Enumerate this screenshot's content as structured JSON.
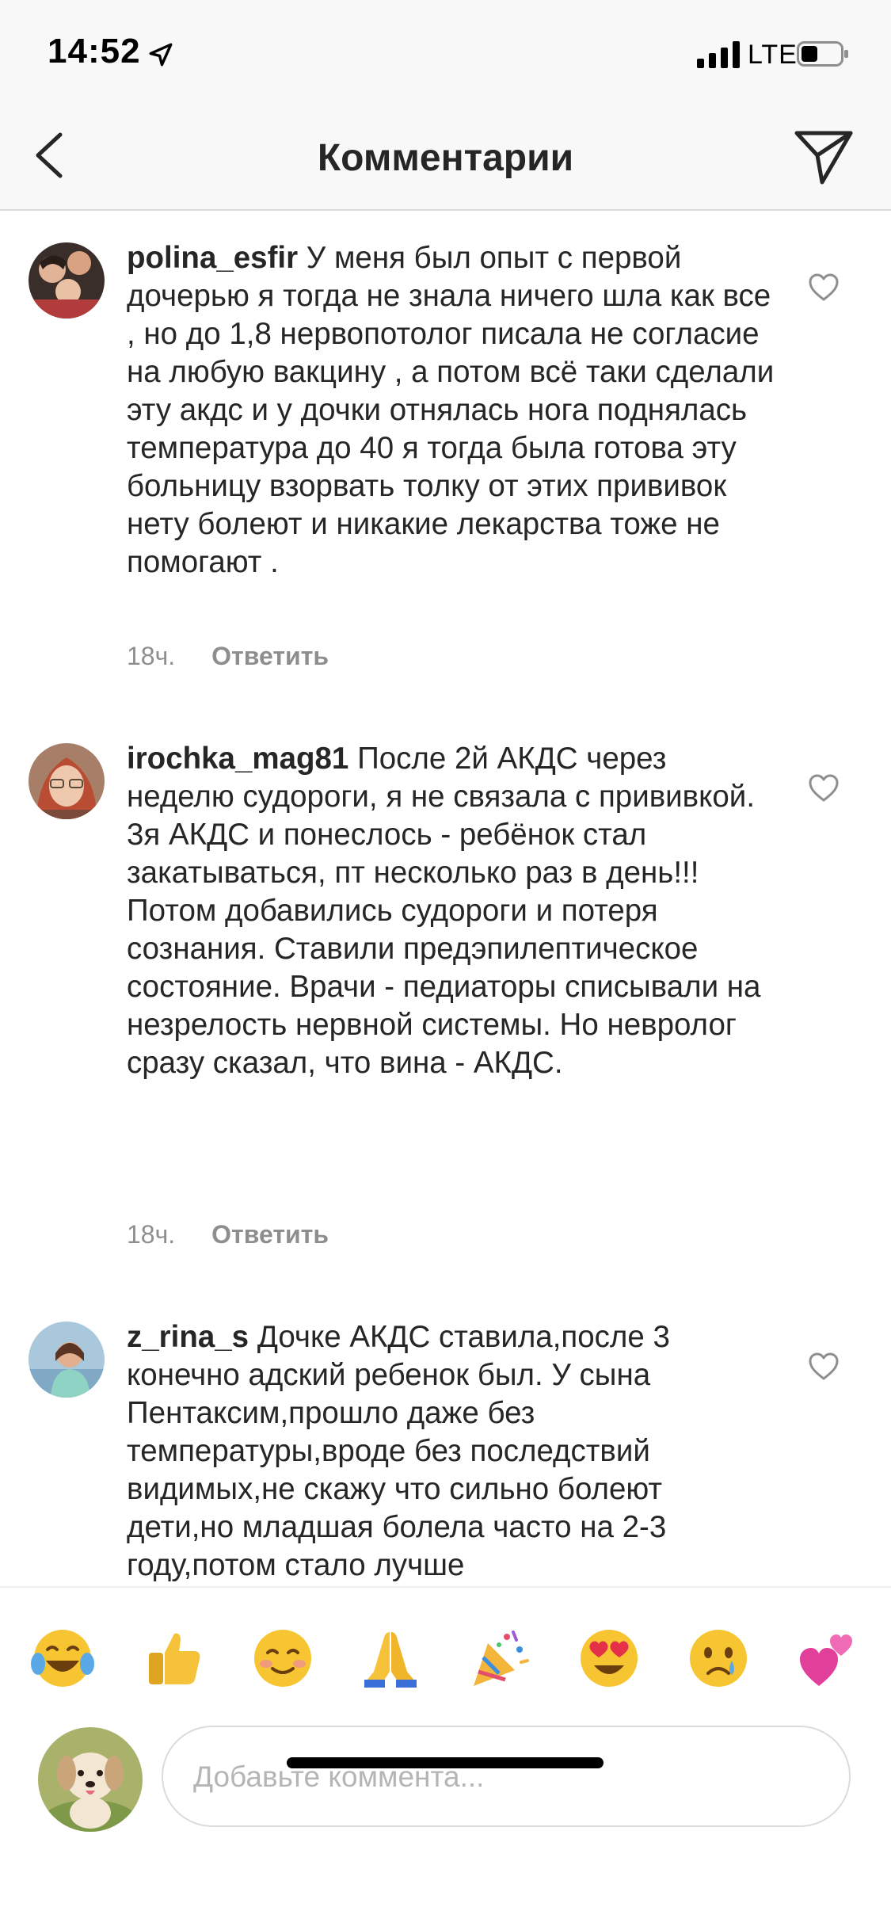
{
  "status_bar": {
    "time": "14:52",
    "network": "LTE",
    "icons": [
      "location-arrow-icon",
      "signal-icon",
      "battery-icon"
    ]
  },
  "nav": {
    "title": "Комментарии",
    "back_icon": "chevron-left-icon",
    "share_icon": "paper-plane-icon"
  },
  "comments": [
    {
      "username": "polina_esfir",
      "text": "У меня был опыт с первой дочерью я тогда не знала ничего шла как все , но до 1,8 нервопотолог писала не согласие на любую вакцину , а потом всё таки сделали эту акдс и у дочки отнялась нога поднялась температура до 40 я тогда была готова эту больницу взорвать толку от этих прививок нету болеют и никакие лекарства тоже не помогают .",
      "time": "18ч.",
      "reply_label": "Ответить"
    },
    {
      "username": "irochka_mag81",
      "text": "После 2й АКДС  через неделю судороги, я не связала с прививкой. 3я АКДС и понеслось - ребёнок стал закатываться, пт несколько раз в день!!! Потом добавились судороги и потеря сознания. Ставили предэпилептическое состояние. Врачи - педиаторы списывали на незрелость нервной системы. Но невролог сразу сказал, что вина - АКДС.",
      "time": "18ч.",
      "reply_label": "Ответить"
    },
    {
      "username": "z_rina_s",
      "text": "Дочке АКДС ставила,после 3 конечно адский ребенок был. У сына Пентаксим,прошло даже без температуры,вроде без последствий видимых,не скажу что сильно болеют дети,но младшая болела часто на 2-3 году,потом стало лучше",
      "time": "",
      "reply_label": ""
    }
  ],
  "emoji_bar": [
    "😂",
    "👍",
    "☺️",
    "🙏",
    "🎉",
    "😍",
    "😢",
    "💕"
  ],
  "composer": {
    "placeholder": "Добавьте коммента..."
  },
  "colors": {
    "text": "#262626",
    "secondary": "#8e8e8e",
    "divider": "#dbdbdb",
    "bar_bg": "#f8f8f8"
  }
}
